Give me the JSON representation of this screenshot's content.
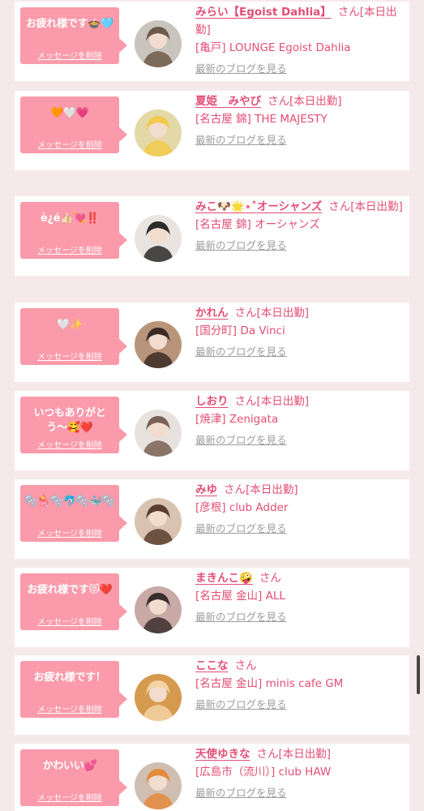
{
  "delete_label": "メッセージを削除",
  "blog_label": "最新のブログを見る",
  "san_label": "さん",
  "colors": {
    "bubble": "#fa9aaa",
    "accent": "#e24e75",
    "link_gray": "#9c9c9c"
  },
  "entries": [
    {
      "message": "お疲れ様です🍲🩵",
      "name": "みらい【Egoist Dahlia】",
      "status": "さん[本日出勤]",
      "store": "[亀戸] LOUNGE Egoist Dahlia"
    },
    {
      "message": "🧡🤍💗",
      "name": "夏姫　みやび",
      "status": "さん[本日出勤]",
      "store": "[名古屋 錦] THE MAJESTY"
    },
    {
      "message": "è¿é👍🏻💘‼️",
      "name": "みこ🐶🌟⋆˚オーシャンズ",
      "status": "さん[本日出勤]",
      "store": "[名古屋 錦] オーシャンズ"
    },
    {
      "message": "🤍✨",
      "name": "かれん",
      "status": "さん[本日出勤]",
      "store": "[国分町] Da Vinci"
    },
    {
      "message": "いつもありがとう〜🥰❤️",
      "name": "しおり",
      "status": "さん[本日出勤]",
      "store": "[焼津] Zenigata"
    },
    {
      "message": "🫧🪼🫧🐬🫧🐳🫧",
      "name": "みゆ",
      "status": "さん[本日出勤]",
      "store": "[彦根] club Adder"
    },
    {
      "message": "お疲れ様です😻❤️",
      "name": "まきんこ🤪",
      "status": "さん",
      "store": "[名古屋 金山] ALL"
    },
    {
      "message": "お疲れ様です！",
      "name": "ここな",
      "status": "さん",
      "store": "[名古屋 金山] minis cafe GM"
    },
    {
      "message": "かわいい💕",
      "name": "天使ゆきな",
      "status": "さん[本日出勤]",
      "store": "[広島市（流川）] club HAW"
    }
  ]
}
